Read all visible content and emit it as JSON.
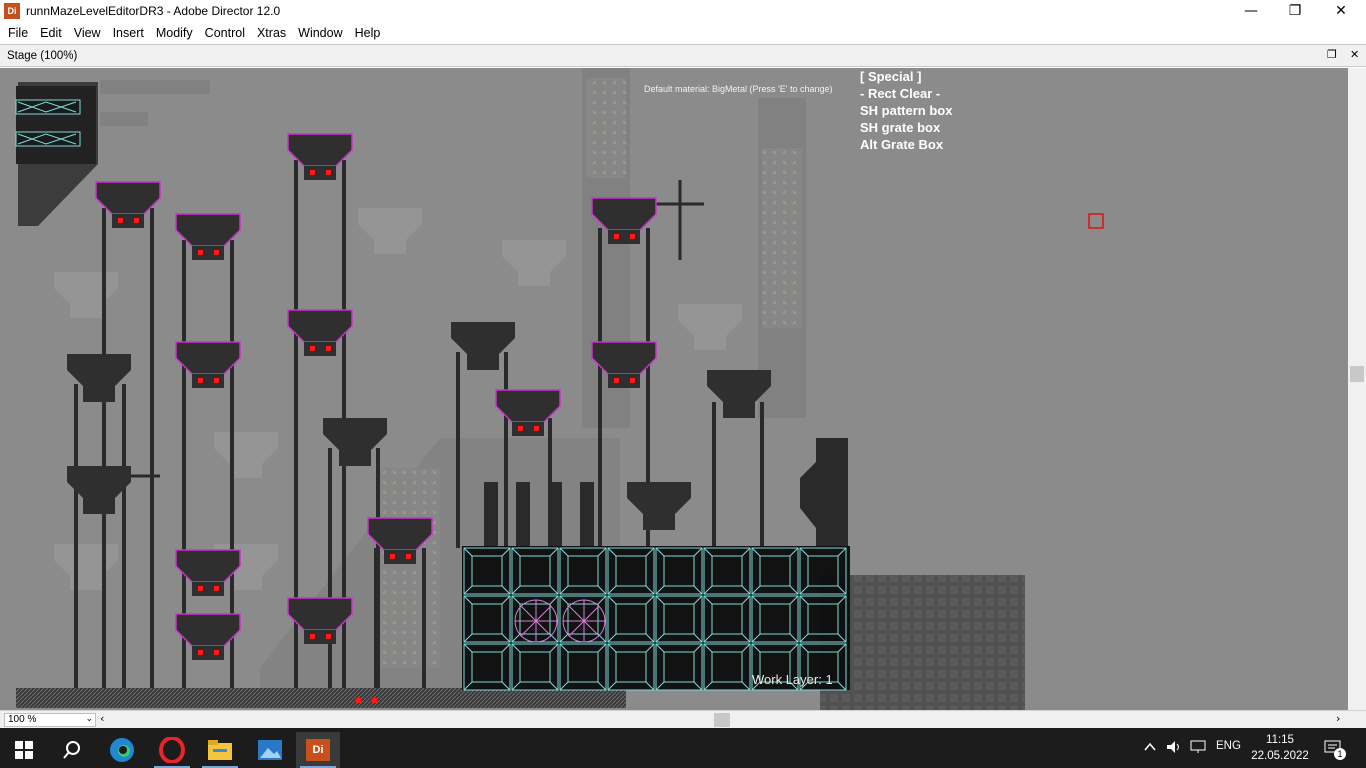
{
  "window": {
    "app_icon_text": "Di",
    "title": "runnMazeLevelEditorDR3 - Adobe Director 12.0",
    "minimize": "—",
    "maximize": "❐",
    "close": "✕"
  },
  "menu": [
    "File",
    "Edit",
    "View",
    "Insert",
    "Modify",
    "Control",
    "Xtras",
    "Window",
    "Help"
  ],
  "stage_window": {
    "title": "Stage (100%)",
    "restore_icon": "❐",
    "close_icon": "✕"
  },
  "stage": {
    "default_material": "Default material: BigMetal (Press 'E' to change)",
    "special_menu": [
      "[ Special ]",
      "- Rect Clear -",
      "SH pattern box",
      "SH grate box",
      "Alt Grate Box"
    ],
    "work_layer": "Work Layer: 1",
    "colors": {
      "background": "#8b8b8b",
      "dark_fixture": "#2a2a2a",
      "magenta_outline": "#cc33cc",
      "red_light": "#ff1a1a",
      "cyan_tile": "#7fdcdc"
    }
  },
  "bottom": {
    "zoom": "100 %",
    "zoom_arrow": "⌄",
    "scroll_left": "‹",
    "scroll_right": "›"
  },
  "taskbar": {
    "apps": [
      "windows-start",
      "search",
      "edge",
      "opera",
      "file-explorer",
      "photos",
      "adobe-director"
    ],
    "director_label": "Di",
    "language": "ENG",
    "time": "11:15",
    "date": "22.05.2022",
    "notification_count": "1"
  }
}
